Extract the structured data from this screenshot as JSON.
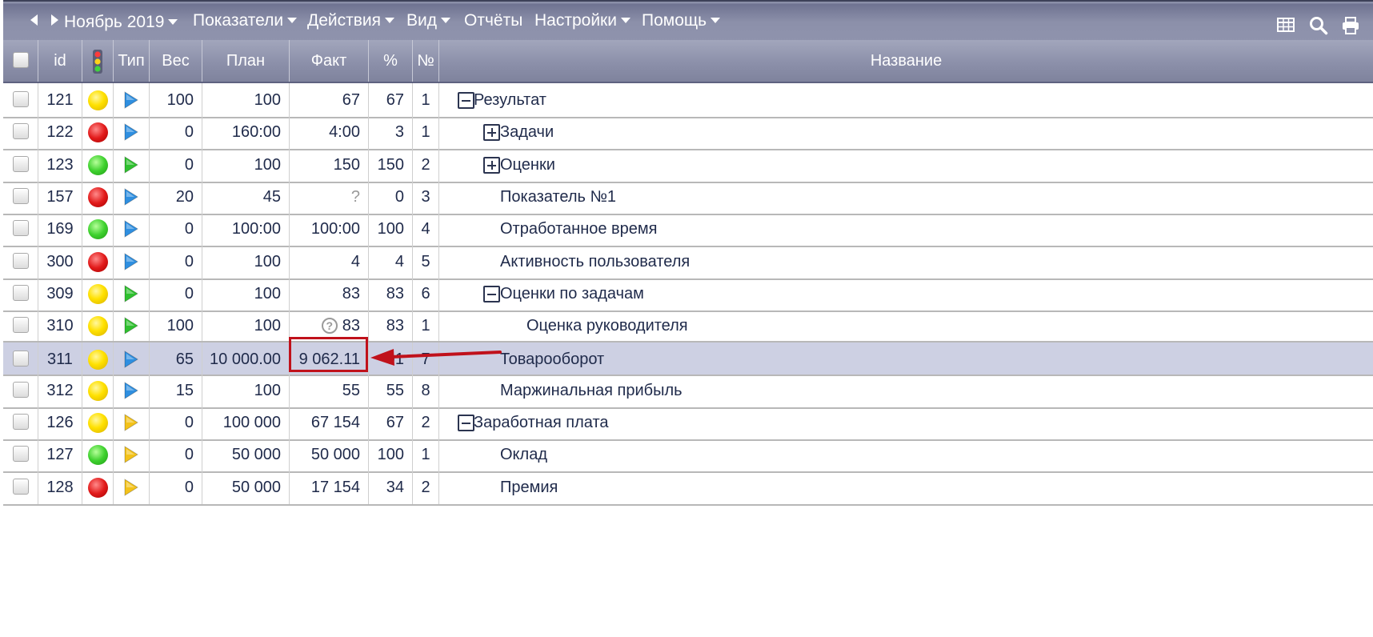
{
  "toolbar": {
    "period": "Ноябрь 2019",
    "menu": [
      {
        "label": "Показатели",
        "dropdown": true
      },
      {
        "label": "Действия",
        "dropdown": true
      },
      {
        "label": "Вид",
        "dropdown": true
      },
      {
        "label": "Отчёты",
        "dropdown": false
      },
      {
        "label": "Настройки",
        "dropdown": true
      },
      {
        "label": "Помощь",
        "dropdown": true
      }
    ],
    "icons": [
      "table-icon",
      "search-icon",
      "print-icon"
    ]
  },
  "columns": {
    "id": "id",
    "status_icon": "traffic-light-icon",
    "type": "Тип",
    "weight": "Вес",
    "plan": "План",
    "fact": "Факт",
    "percent": "%",
    "num": "№",
    "name": "Название"
  },
  "rows": [
    {
      "id": "121",
      "status": "yellow",
      "type_color": "blue",
      "weight": "100",
      "plan": "100",
      "fact": "67",
      "fact_mark": "",
      "percent": "67",
      "num": "1",
      "name": "Результат",
      "level": 0,
      "toggle": "minus"
    },
    {
      "id": "122",
      "status": "red",
      "type_color": "blue",
      "weight": "0",
      "plan": "160:00",
      "fact": "4:00",
      "fact_mark": "",
      "percent": "3",
      "num": "1",
      "name": "Задачи",
      "level": 1,
      "toggle": "plus"
    },
    {
      "id": "123",
      "status": "green",
      "type_color": "green",
      "weight": "0",
      "plan": "100",
      "fact": "150",
      "fact_mark": "",
      "percent": "150",
      "num": "2",
      "name": "Оценки",
      "level": 1,
      "toggle": "plus"
    },
    {
      "id": "157",
      "status": "red",
      "type_color": "blue",
      "weight": "20",
      "plan": "45",
      "fact": "?",
      "fact_mark": "plain",
      "percent": "0",
      "num": "3",
      "name": "Показатель №1",
      "level": 1,
      "toggle": ""
    },
    {
      "id": "169",
      "status": "green",
      "type_color": "blue",
      "weight": "0",
      "plan": "100:00",
      "fact": "100:00",
      "fact_mark": "",
      "percent": "100",
      "num": "4",
      "name": "Отработанное время",
      "level": 1,
      "toggle": ""
    },
    {
      "id": "300",
      "status": "red",
      "type_color": "blue",
      "weight": "0",
      "plan": "100",
      "fact": "4",
      "fact_mark": "",
      "percent": "4",
      "num": "5",
      "name": "Активность пользователя",
      "level": 1,
      "toggle": ""
    },
    {
      "id": "309",
      "status": "yellow",
      "type_color": "green",
      "weight": "0",
      "plan": "100",
      "fact": "83",
      "fact_mark": "",
      "percent": "83",
      "num": "6",
      "name": "Оценки по задачам",
      "level": 1,
      "toggle": "minus"
    },
    {
      "id": "310",
      "status": "yellow",
      "type_color": "green",
      "weight": "100",
      "plan": "100",
      "fact": "83",
      "fact_mark": "circle",
      "percent": "83",
      "num": "1",
      "name": "Оценка руководителя",
      "level": 2,
      "toggle": ""
    },
    {
      "id": "311",
      "status": "yellow",
      "type_color": "blue",
      "weight": "65",
      "plan": "10 000.00",
      "fact": "9 062.11",
      "fact_mark": "",
      "percent": "91",
      "num": "7",
      "name": "Товарооборот",
      "level": 1,
      "toggle": "",
      "selected": true
    },
    {
      "id": "312",
      "status": "yellow",
      "type_color": "blue",
      "weight": "15",
      "plan": "100",
      "fact": "55",
      "fact_mark": "",
      "percent": "55",
      "num": "8",
      "name": "Маржинальная прибыль",
      "level": 1,
      "toggle": ""
    },
    {
      "id": "126",
      "status": "yellow",
      "type_color": "yellow",
      "weight": "0",
      "plan": "100 000",
      "fact": "67 154",
      "fact_mark": "",
      "percent": "67",
      "num": "2",
      "name": "Заработная плата",
      "level": 0,
      "toggle": "minus"
    },
    {
      "id": "127",
      "status": "green",
      "type_color": "yellow",
      "weight": "0",
      "plan": "50 000",
      "fact": "50 000",
      "fact_mark": "",
      "percent": "100",
      "num": "1",
      "name": "Оклад",
      "level": 1,
      "toggle": ""
    },
    {
      "id": "128",
      "status": "red",
      "type_color": "yellow",
      "weight": "0",
      "plan": "50 000",
      "fact": "17 154",
      "fact_mark": "",
      "percent": "34",
      "num": "2",
      "name": "Премия",
      "level": 1,
      "toggle": ""
    }
  ],
  "colors": {
    "type_blue": "#2f8fe0",
    "type_green": "#2fc02f",
    "type_yellow": "#f3c21a",
    "annotation": "#c0111b",
    "selected_row": "#cdd0e3"
  }
}
